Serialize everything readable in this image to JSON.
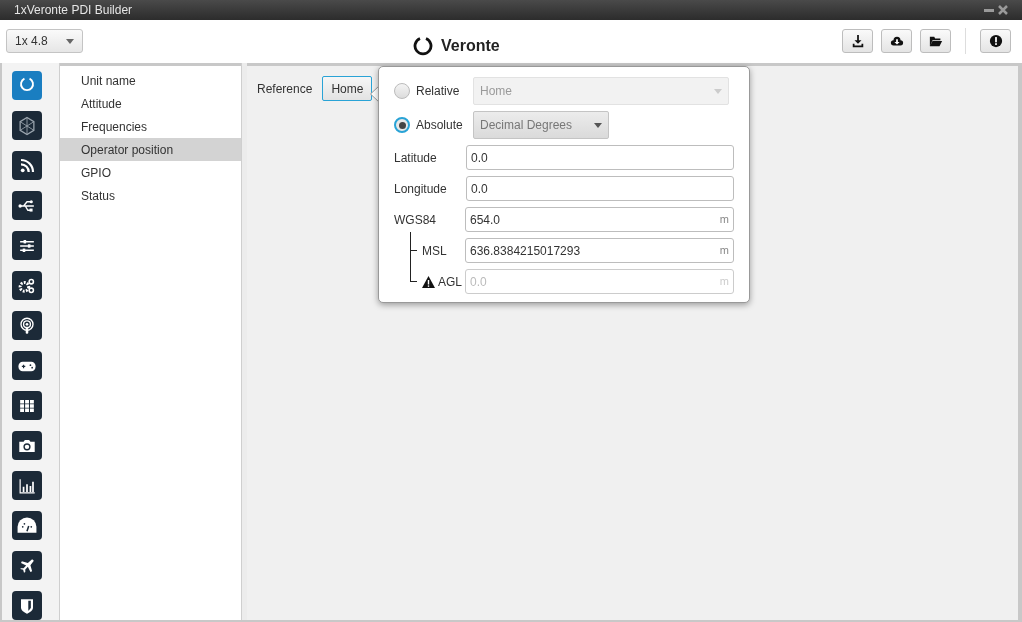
{
  "window": {
    "title": "1xVeronte PDI Builder"
  },
  "version_select": {
    "value": "1x 4.8"
  },
  "app_title": "Veronte",
  "toolbar": [
    {
      "kind": "download"
    },
    {
      "kind": "cloud"
    },
    {
      "kind": "folder"
    },
    {
      "kind": "alert"
    }
  ],
  "nav_icons": [
    {
      "kind": "ring",
      "selected": true
    },
    {
      "kind": "hexagon",
      "selected": false
    },
    {
      "kind": "rss",
      "selected": false
    },
    {
      "kind": "usb",
      "selected": false
    },
    {
      "kind": "sliders",
      "selected": false
    },
    {
      "kind": "gears",
      "selected": false
    },
    {
      "kind": "podcast",
      "selected": false
    },
    {
      "kind": "gamepad",
      "selected": false
    },
    {
      "kind": "grid",
      "selected": false
    },
    {
      "kind": "camera",
      "selected": false
    },
    {
      "kind": "chart",
      "selected": false
    },
    {
      "kind": "gauge",
      "selected": false
    },
    {
      "kind": "plane",
      "selected": false
    },
    {
      "kind": "shield",
      "selected": false
    }
  ],
  "sidebar": {
    "items": [
      {
        "label": "Unit name",
        "selected": false
      },
      {
        "label": "Attitude",
        "selected": false
      },
      {
        "label": "Frequencies",
        "selected": false
      },
      {
        "label": "Operator position",
        "selected": true
      },
      {
        "label": "GPIO",
        "selected": false
      },
      {
        "label": "Status",
        "selected": false
      }
    ]
  },
  "reference": {
    "label": "Reference",
    "button": "Home"
  },
  "popup": {
    "options": [
      {
        "label": "Relative",
        "selected": false,
        "dropdown": {
          "value": "Home",
          "disabled": true
        }
      },
      {
        "label": "Absolute",
        "selected": true,
        "dropdown": {
          "value": "Decimal Degrees",
          "disabled": false
        }
      }
    ],
    "fields": [
      {
        "label": "Latitude",
        "value": "0.0",
        "disabled": false
      },
      {
        "label": "Longitude",
        "value": "0.0",
        "disabled": false
      }
    ],
    "altitude": {
      "label": "WGS84",
      "value": "654.0",
      "unit": "m",
      "disabled": false,
      "children": [
        {
          "label": "MSL",
          "value": "636.8384215017293",
          "unit": "m",
          "disabled": false,
          "warning": false
        },
        {
          "label": "AGL",
          "value": "0.0",
          "unit": "m",
          "disabled": true,
          "warning": true
        }
      ]
    }
  }
}
